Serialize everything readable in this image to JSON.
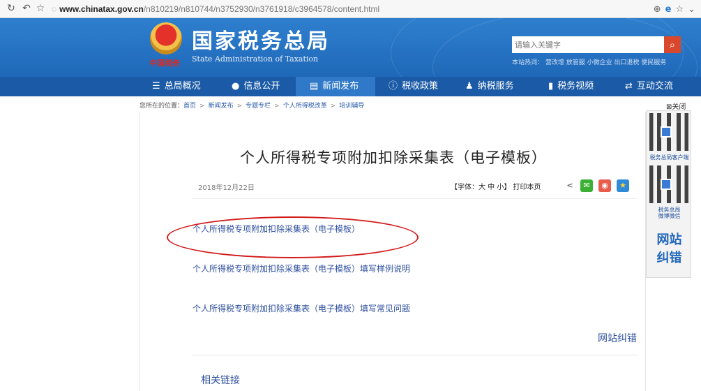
{
  "browser": {
    "url_domain": "www.chinatax.gov.cn",
    "url_path": "/n810219/n810744/n3752930/n3761918/c3964578/content.html"
  },
  "header": {
    "emblem_caption": "中国税务",
    "title_cn": "国家税务总局",
    "title_en": "State Administration of Taxation",
    "search_placeholder": "请输入关键字",
    "hot_words": "本站热词： 营改增  放管服  小微企业  出口退税  便民服务"
  },
  "nav": {
    "items": [
      {
        "label": "总局概况",
        "icon": "list-icon"
      },
      {
        "label": "信息公开",
        "icon": "chat-icon"
      },
      {
        "label": "新闻发布",
        "icon": "news-icon"
      },
      {
        "label": "税收政策",
        "icon": "info-icon"
      },
      {
        "label": "纳税服务",
        "icon": "person-icon"
      },
      {
        "label": "税务视频",
        "icon": "video-icon"
      },
      {
        "label": "互动交流",
        "icon": "exchange-icon"
      }
    ]
  },
  "breadcrumb": {
    "prefix": "您所在的位置：",
    "items": [
      "首页",
      "新闻发布",
      "专题专栏",
      "个人所得税改革",
      "培训辅导"
    ]
  },
  "side": {
    "close_label": "关闭",
    "qr1_caption": "税务总局客户端",
    "qr2_caption_1": "税务总局",
    "qr2_caption_2": "微博微信",
    "correct_1": "网站",
    "correct_2": "纠错"
  },
  "article": {
    "title": "个人所得税专项附加扣除采集表（电子模板）",
    "date": "2018年12月22日",
    "font_tools": "【字体：大  中  小】  打印本页",
    "links": [
      "个人所得税专项附加扣除采集表（电子模板）",
      "个人所得税专项附加扣除采集表（电子模板）填写样例说明",
      "个人所得税专项附加扣除采集表（电子模板）填写常见问题"
    ],
    "correct_link": "网站纠错",
    "related_heading": "相关链接"
  },
  "colors": {
    "header_blue": "#2a74c4",
    "nav_blue": "#1a5aa6",
    "link_blue": "#2d4f9e",
    "annotation_red": "#d21a1a"
  }
}
